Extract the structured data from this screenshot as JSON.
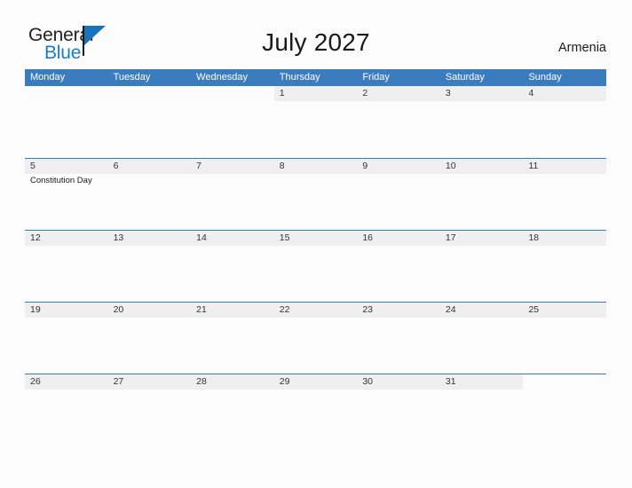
{
  "brand": {
    "name_part1": "General",
    "name_part2": "Blue",
    "triangle_icon": "triangle-icon",
    "accent_color": "#1a7dc4"
  },
  "header": {
    "title": "July 2027",
    "country": "Armenia"
  },
  "colors": {
    "header_blue": "#3b7cbe",
    "date_band_gray": "#efefef",
    "page_background": "#fcfcfc",
    "text_dark": "#1a1a1a"
  },
  "calendar": {
    "weekdays": [
      "Monday",
      "Tuesday",
      "Wednesday",
      "Thursday",
      "Friday",
      "Saturday",
      "Sunday"
    ],
    "weeks": [
      [
        {
          "date": "",
          "events": []
        },
        {
          "date": "",
          "events": []
        },
        {
          "date": "",
          "events": []
        },
        {
          "date": "1",
          "events": []
        },
        {
          "date": "2",
          "events": []
        },
        {
          "date": "3",
          "events": []
        },
        {
          "date": "4",
          "events": []
        }
      ],
      [
        {
          "date": "5",
          "events": [
            "Constitution Day"
          ]
        },
        {
          "date": "6",
          "events": []
        },
        {
          "date": "7",
          "events": []
        },
        {
          "date": "8",
          "events": []
        },
        {
          "date": "9",
          "events": []
        },
        {
          "date": "10",
          "events": []
        },
        {
          "date": "11",
          "events": []
        }
      ],
      [
        {
          "date": "12",
          "events": []
        },
        {
          "date": "13",
          "events": []
        },
        {
          "date": "14",
          "events": []
        },
        {
          "date": "15",
          "events": []
        },
        {
          "date": "16",
          "events": []
        },
        {
          "date": "17",
          "events": []
        },
        {
          "date": "18",
          "events": []
        }
      ],
      [
        {
          "date": "19",
          "events": []
        },
        {
          "date": "20",
          "events": []
        },
        {
          "date": "21",
          "events": []
        },
        {
          "date": "22",
          "events": []
        },
        {
          "date": "23",
          "events": []
        },
        {
          "date": "24",
          "events": []
        },
        {
          "date": "25",
          "events": []
        }
      ],
      [
        {
          "date": "26",
          "events": []
        },
        {
          "date": "27",
          "events": []
        },
        {
          "date": "28",
          "events": []
        },
        {
          "date": "29",
          "events": []
        },
        {
          "date": "30",
          "events": []
        },
        {
          "date": "31",
          "events": []
        },
        {
          "date": "",
          "events": []
        }
      ]
    ]
  }
}
